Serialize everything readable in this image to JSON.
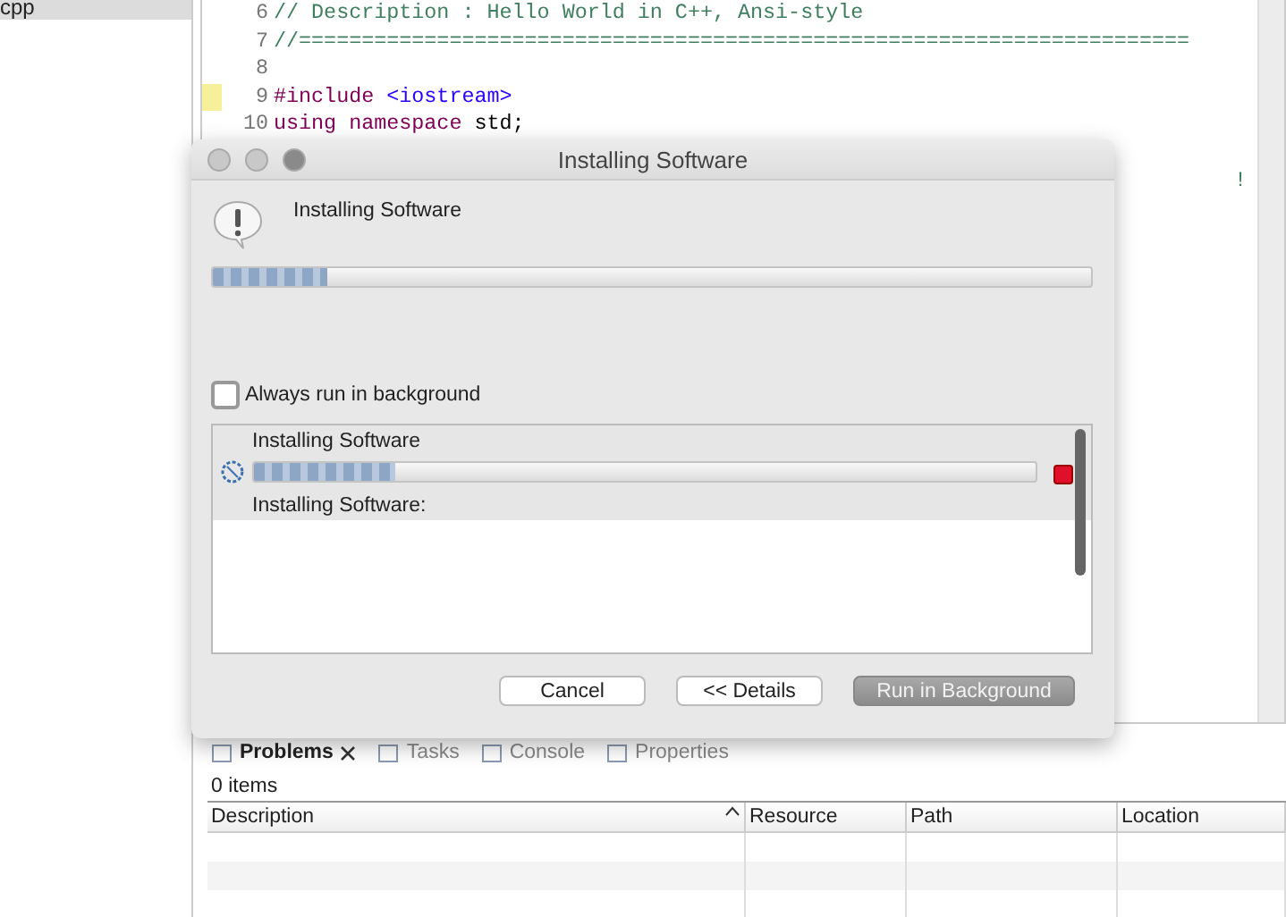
{
  "sidebar": {
    "items": [
      {
        "label": "cpp",
        "selected": true
      }
    ]
  },
  "editor": {
    "lines": [
      {
        "number": "6",
        "kind": "comment",
        "text": "// Description : Hello World in C++, Ansi-style",
        "marked": false
      },
      {
        "number": "7",
        "kind": "comment",
        "text": "//=======================================================================",
        "marked": false
      },
      {
        "number": "8",
        "marked": false
      },
      {
        "number": "9",
        "kind": "include",
        "text": "#include",
        "arg": "<iostream>",
        "marked": true
      },
      {
        "number": "10",
        "kind": "using",
        "text": "using namespace",
        "arg": "std;",
        "marked": false
      }
    ],
    "overflow_text": "!"
  },
  "dialog": {
    "title": "Installing Software",
    "message": "Installing Software",
    "level": 0.13,
    "checkbox": {
      "label": "Always run in background",
      "checked": false
    },
    "job": {
      "name": "Installing Software",
      "level": 0.18,
      "status": "Installing Software:"
    },
    "buttons": [
      {
        "label": "Cancel",
        "default": false
      },
      {
        "label": "<< Details",
        "default": false
      },
      {
        "label": "Run in Background",
        "default": true
      }
    ]
  },
  "panel": {
    "tabs": [
      {
        "label": "Problems",
        "selected": true,
        "closable": true
      },
      {
        "label": "Tasks",
        "selected": false,
        "closable": false
      },
      {
        "label": "Console",
        "selected": false,
        "closable": false
      },
      {
        "label": "Properties",
        "selected": false,
        "closable": false
      }
    ],
    "count": "0 items",
    "columns": [
      {
        "label": "Description",
        "sorted": true
      },
      {
        "label": "Resource",
        "sorted": false
      },
      {
        "label": "Path",
        "sorted": false
      },
      {
        "label": "Location",
        "sorted": false
      }
    ]
  }
}
